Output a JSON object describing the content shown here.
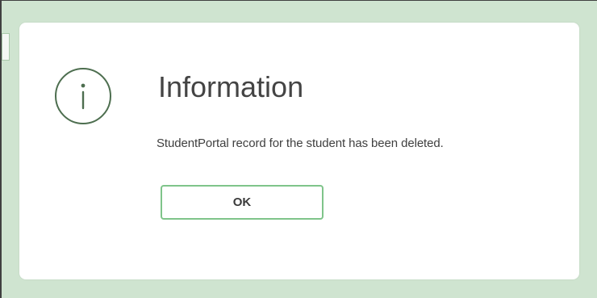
{
  "dialog": {
    "icon": "info-icon",
    "title": "Information",
    "message": "StudentPortal record for the student has been deleted.",
    "ok_label": "OK"
  },
  "colors": {
    "backdrop": "#cfe4d0",
    "icon_stroke": "#4d6e4f",
    "button_border": "#7fc48a",
    "title_text": "#444444"
  }
}
